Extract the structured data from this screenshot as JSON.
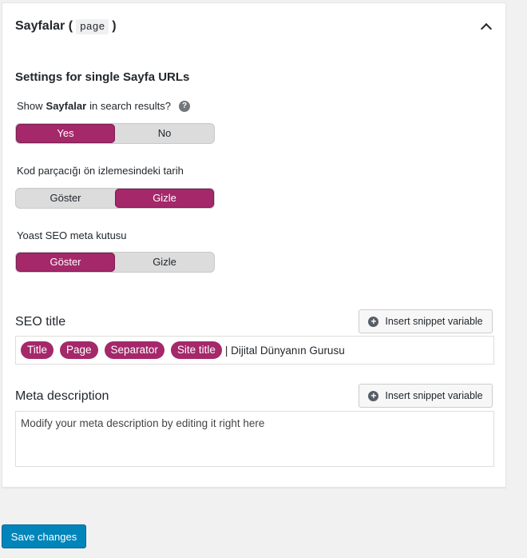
{
  "panel": {
    "title_prefix": "Sayfalar (",
    "title_code": "page",
    "title_suffix": ")",
    "section_title": "Settings for single Sayfa URLs"
  },
  "search_results": {
    "label_pre": "Show",
    "label_bold": "Sayfalar",
    "label_post": "in search results?",
    "help": "?",
    "options": [
      "Yes",
      "No"
    ],
    "selected": "Yes"
  },
  "snippet_date": {
    "label": "Kod parçacığı ön izlemesindeki tarih",
    "options": [
      "Göster",
      "Gizle"
    ],
    "selected": "Gizle"
  },
  "meta_box": {
    "label": "Yoast SEO meta kutusu",
    "options": [
      "Göster",
      "Gizle"
    ],
    "selected": "Göster"
  },
  "seo_title": {
    "label": "SEO title",
    "insert_button": "Insert snippet variable",
    "pills": [
      "Title",
      "Page",
      "Separator",
      "Site title"
    ],
    "text": "| Dijital Dünyanın Gurusu"
  },
  "meta_description": {
    "label": "Meta description",
    "insert_button": "Insert snippet variable",
    "placeholder": "Modify your meta description by editing it right here"
  },
  "save_button": "Save changes",
  "colors": {
    "accent": "#a4286a",
    "primary_button": "#0085ba"
  }
}
